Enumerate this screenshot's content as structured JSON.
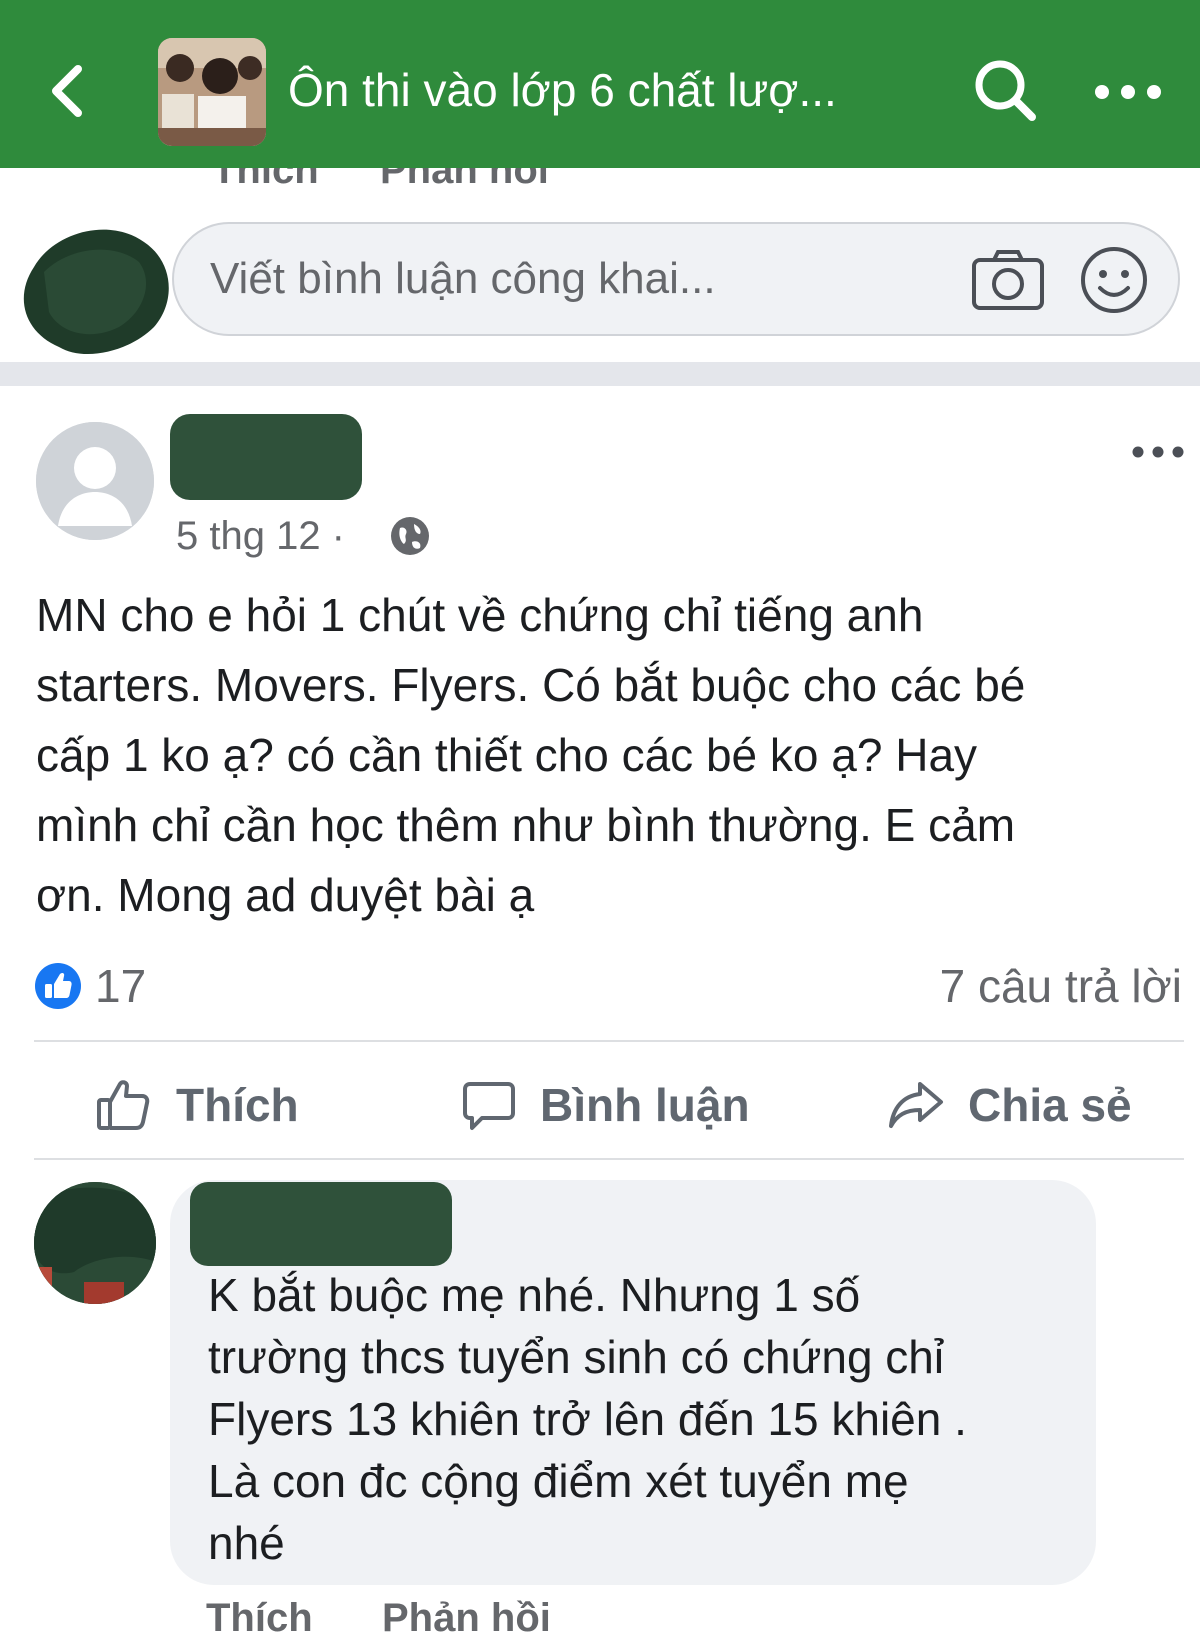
{
  "header": {
    "title": "Ôn thi vào lớp 6 chất lượ..."
  },
  "prev_comment_actions": {
    "like": "Thích",
    "reply": "Phản hồi"
  },
  "composer": {
    "placeholder": "Viết bình luận công khai..."
  },
  "post": {
    "time": "5 thg 12 ·",
    "body_lines": [
      "MN cho e hỏi 1 chút về chứng chỉ tiếng anh",
      "starters. Movers. Flyers. Có bắt buộc cho các bé",
      "cấp 1 ko ạ? có cần thiết cho các bé ko ạ? Hay",
      "mình chỉ cần học thêm như bình thường. E cảm",
      "ơn. Mong ad duyệt bài ạ"
    ],
    "like_count": "17",
    "reply_count": "7 câu trả lời",
    "actions": {
      "like": "Thích",
      "comment": "Bình luận",
      "share": "Chia sẻ"
    }
  },
  "reply": {
    "text_lines": [
      "K bắt buộc mẹ nhé. Nhưng 1 số",
      "trường thcs tuyển sinh có chứng chỉ",
      "Flyers 13 khiên trở lên đến 15 khiên .",
      "Là con đc cộng điểm xét tuyển mẹ",
      "nhé"
    ],
    "actions": {
      "like": "Thích",
      "reply": "Phản hồi"
    }
  },
  "colors": {
    "header_bg": "#2f8b3c",
    "like_blue": "#1877f2",
    "muted_text": "#65676b",
    "bubble_bg": "#f0f2f5"
  },
  "icons": [
    "back-arrow-icon",
    "search-icon",
    "more-icon",
    "camera-icon",
    "emoji-icon",
    "globe-icon",
    "like-badge-icon",
    "thumbs-up-icon",
    "comment-icon",
    "share-icon"
  ]
}
